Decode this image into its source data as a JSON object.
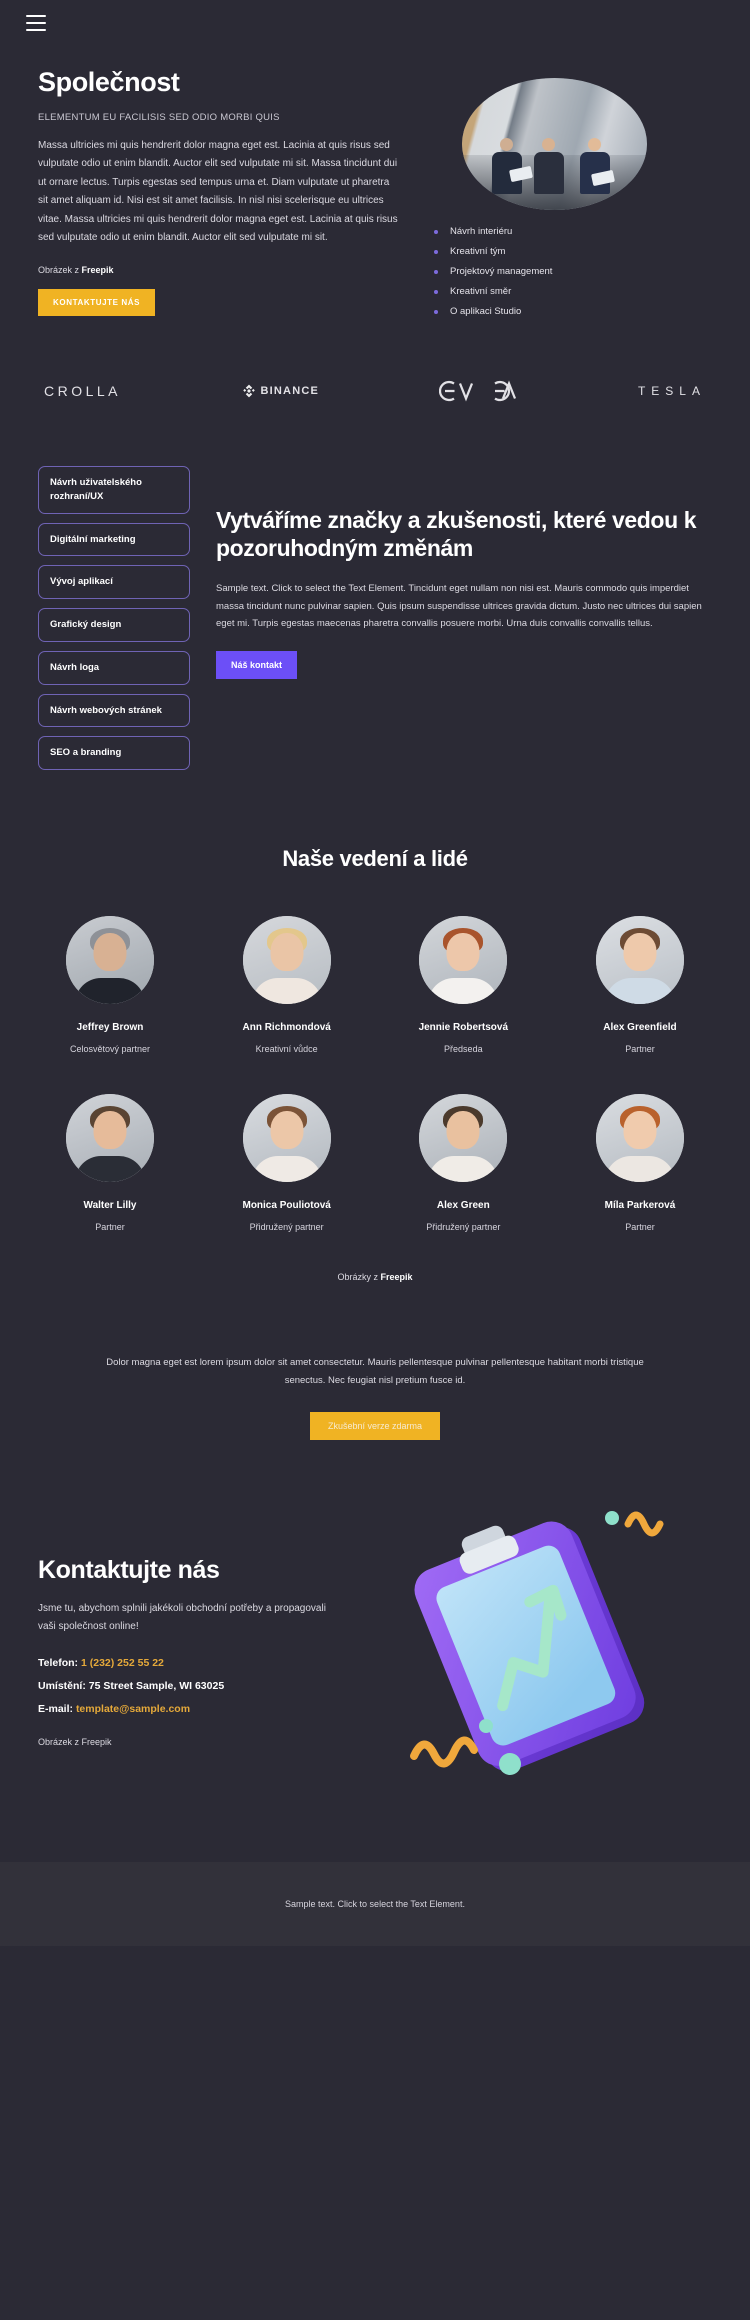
{
  "header": {
    "menu_icon": "hamburger-menu-icon"
  },
  "about": {
    "title": "Společnost",
    "eyebrow": "ELEMENTUM EU FACILISIS SED ODIO MORBI QUIS",
    "body": "Massa ultricies mi quis hendrerit dolor magna eget est. Lacinia at quis risus sed vulputate odio ut enim blandit. Auctor elit sed vulputate mi sit. Massa tincidunt dui ut ornare lectus. Turpis egestas sed tempus urna et. Diam vulputate ut pharetra sit amet aliquam id. Nisi est sit amet facilisis. In nisl nisi scelerisque eu ultrices vitae. Massa ultricies mi quis hendrerit dolor magna eget est. Lacinia at quis risus sed vulputate odio ut enim blandit. Auctor elit sed vulputate mi sit.",
    "credit_prefix": "Obrázek z ",
    "credit_source": "Freepik",
    "cta_label": "KONTAKTUJTE NÁS",
    "image_alt": "office-meeting-photo",
    "features": [
      "Návrh interiéru",
      "Kreativní tým",
      "Projektový management",
      "Kreativní směr",
      "O aplikaci Studio"
    ]
  },
  "logos": [
    {
      "name": "crolla",
      "text": "CROLLA"
    },
    {
      "name": "binance",
      "text": "BINANCE"
    },
    {
      "name": "evga",
      "text": "EVGA"
    },
    {
      "name": "tesla",
      "text": "TESLA"
    }
  ],
  "services": {
    "chips": [
      "Návrh uživatelského rozhraní/UX",
      "Digitální marketing",
      "Vývoj aplikací",
      "Grafický design",
      "Návrh loga",
      "Návrh webových stránek",
      "SEO a branding"
    ],
    "title": "Vytváříme značky a zkušenosti, které vedou k pozoruhodným změnám",
    "body": "Sample text. Click to select the Text Element. Tincidunt eget nullam non nisi est. Mauris commodo quis imperdiet massa tincidunt nunc pulvinar sapien. Quis ipsum suspendisse ultrices gravida dictum. Justo nec ultrices dui sapien eget mi. Turpis egestas maecenas pharetra convallis posuere morbi. Urna duis convallis convallis tellus.",
    "cta_label": "Náš kontakt"
  },
  "team": {
    "title": "Naše vedení a lidé",
    "row1": [
      {
        "name": "Jeffrey Brown",
        "role": "Celosvětový partner"
      },
      {
        "name": "Ann Richmondová",
        "role": "Kreativní vůdce"
      },
      {
        "name": "Jennie Robertsová",
        "role": "Předseda"
      },
      {
        "name": "Alex Greenfield",
        "role": "Partner"
      }
    ],
    "row2": [
      {
        "name": "Walter Lilly",
        "role": "Partner"
      },
      {
        "name": "Monica Pouliotová",
        "role": "Přidružený partner"
      },
      {
        "name": "Alex Green",
        "role": "Přidružený partner"
      },
      {
        "name": "Míla Parkerová",
        "role": "Partner"
      }
    ],
    "credit_prefix": "Obrázky z ",
    "credit_source": "Freepik"
  },
  "cta": {
    "text": "Dolor magna eget est lorem ipsum dolor sit amet consectetur. Mauris pellentesque pulvinar pellentesque habitant morbi tristique senectus. Nec feugiat nisl pretium fusce id.",
    "button_label": "Zkušební verze zdarma"
  },
  "contact": {
    "title": "Kontaktujte nás",
    "lead": "Jsme tu, abychom splnili jakékoli obchodní potřeby a propagovali vaši společnost online!",
    "phone_label": "Telefon:",
    "phone_value": "1 (232) 252 55 22",
    "location_label": "Umístění:",
    "location_value": "75 Street Sample, WI 63025",
    "email_label": "E-mail:",
    "email_value": "template@sample.com",
    "credit": "Obrázek z Freepik",
    "illustration_alt": "clipboard-chart-illustration"
  },
  "footer": {
    "text": "Sample text. Click to select the Text Element."
  },
  "colors": {
    "page_bg": "#2b2a35",
    "footer_bg": "#32313a",
    "accent_yellow": "#f0b323",
    "accent_purple": "#6c4ff7",
    "chip_border": "#6f63b4",
    "bullet": "#7c6bdc",
    "link_yellow": "#e5a93a"
  }
}
